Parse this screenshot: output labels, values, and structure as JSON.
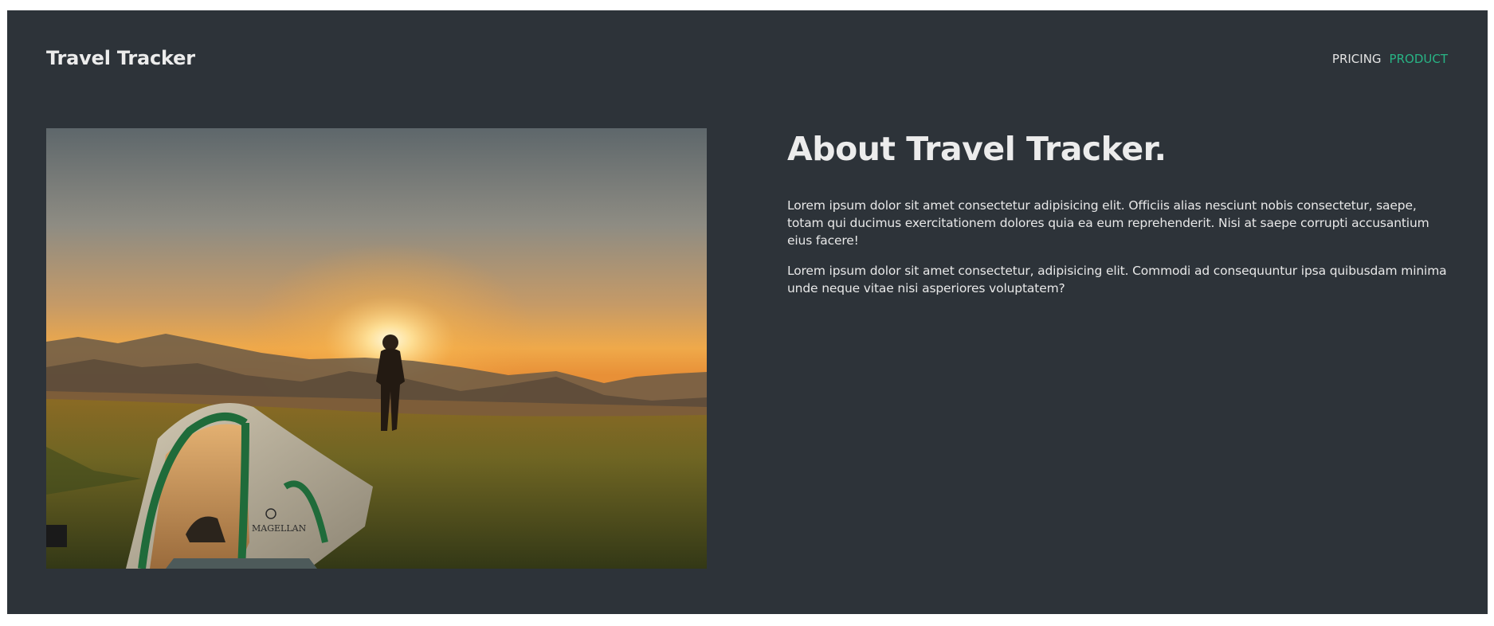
{
  "header": {
    "logo": "Travel Tracker",
    "nav": [
      {
        "label": "PRICING",
        "active": false
      },
      {
        "label": "PRODUCT",
        "active": true
      }
    ]
  },
  "hero_image": {
    "brand_on_tent": "MAGELLAN"
  },
  "about": {
    "title": "About Travel Tracker.",
    "paragraphs": [
      "Lorem ipsum dolor sit amet consectetur adipisicing elit. Officiis alias nesciunt nobis consectetur, saepe, totam qui ducimus exercitationem dolores quia ea eum reprehenderit. Nisi at saepe corrupti accusantium eius facere!",
      "Lorem ipsum dolor sit amet consectetur, adipisicing elit. Commodi ad consequuntur ipsa quibusdam minima unde neque vitae nisi asperiores voluptatem?"
    ]
  },
  "colors": {
    "background": "#2d3339",
    "accent": "#28b485",
    "text": "#ececec"
  }
}
